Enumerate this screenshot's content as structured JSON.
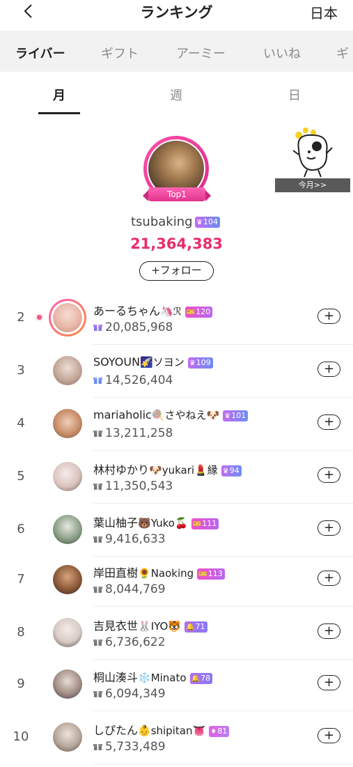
{
  "header": {
    "title": "ランキング",
    "region": "日本",
    "back_icon": "chevron-left-icon"
  },
  "categories": [
    "ライバー",
    "ギフト",
    "アーミー",
    "いいね",
    "ギ"
  ],
  "periods": [
    "月",
    "週",
    "日"
  ],
  "top1": {
    "badge": "Top1",
    "name": "tsubaking",
    "level": "104",
    "score": "21,364,383",
    "follow_label": "+フォロー"
  },
  "promo": {
    "label": "今月>>"
  },
  "ranking": [
    {
      "rank": "2",
      "name": "あーるちゃん",
      "suffix": "🦄ℛ",
      "level": "120",
      "level_icon": "ticket",
      "score": "20,085,968"
    },
    {
      "rank": "3",
      "name": "SOYOUN",
      "suffix": "🌠ソヨン",
      "level": "109",
      "level_icon": "crown",
      "score": "14,526,404"
    },
    {
      "rank": "4",
      "name": "mariaholic",
      "suffix": "🍭さやねえ🐶",
      "level": "101",
      "level_icon": "crown",
      "score": "13,211,258"
    },
    {
      "rank": "5",
      "name": "林村ゆかり",
      "suffix": "🐶yukari💄縁",
      "level": "94",
      "level_icon": "crown",
      "score": "11,350,543"
    },
    {
      "rank": "6",
      "name": "葉山柚子",
      "suffix": "🐻Yuko🍒",
      "level": "111",
      "level_icon": "ticket",
      "score": "9,416,633"
    },
    {
      "rank": "7",
      "name": "岸田直樹",
      "suffix": "🌻Naoking",
      "level": "113",
      "level_icon": "ticket",
      "score": "8,044,769"
    },
    {
      "rank": "8",
      "name": "吉見衣世",
      "suffix": "🐰IYO🐯",
      "level": "71",
      "level_icon": "bell",
      "score": "6,736,622"
    },
    {
      "rank": "9",
      "name": "桐山湊斗",
      "suffix": "❄️Minato",
      "level": "78",
      "level_icon": "bell",
      "score": "6,094,349"
    },
    {
      "rank": "10",
      "name": "しぴたん",
      "suffix": "👶shipitan👅",
      "level": "81",
      "level_icon": "gem",
      "score": "5,733,489"
    }
  ],
  "follow_plus_label": "+",
  "colors": {
    "accent": "#ea2d6a",
    "tab_bg": "#f2f2f2",
    "top1_ring": "#e2348e"
  }
}
